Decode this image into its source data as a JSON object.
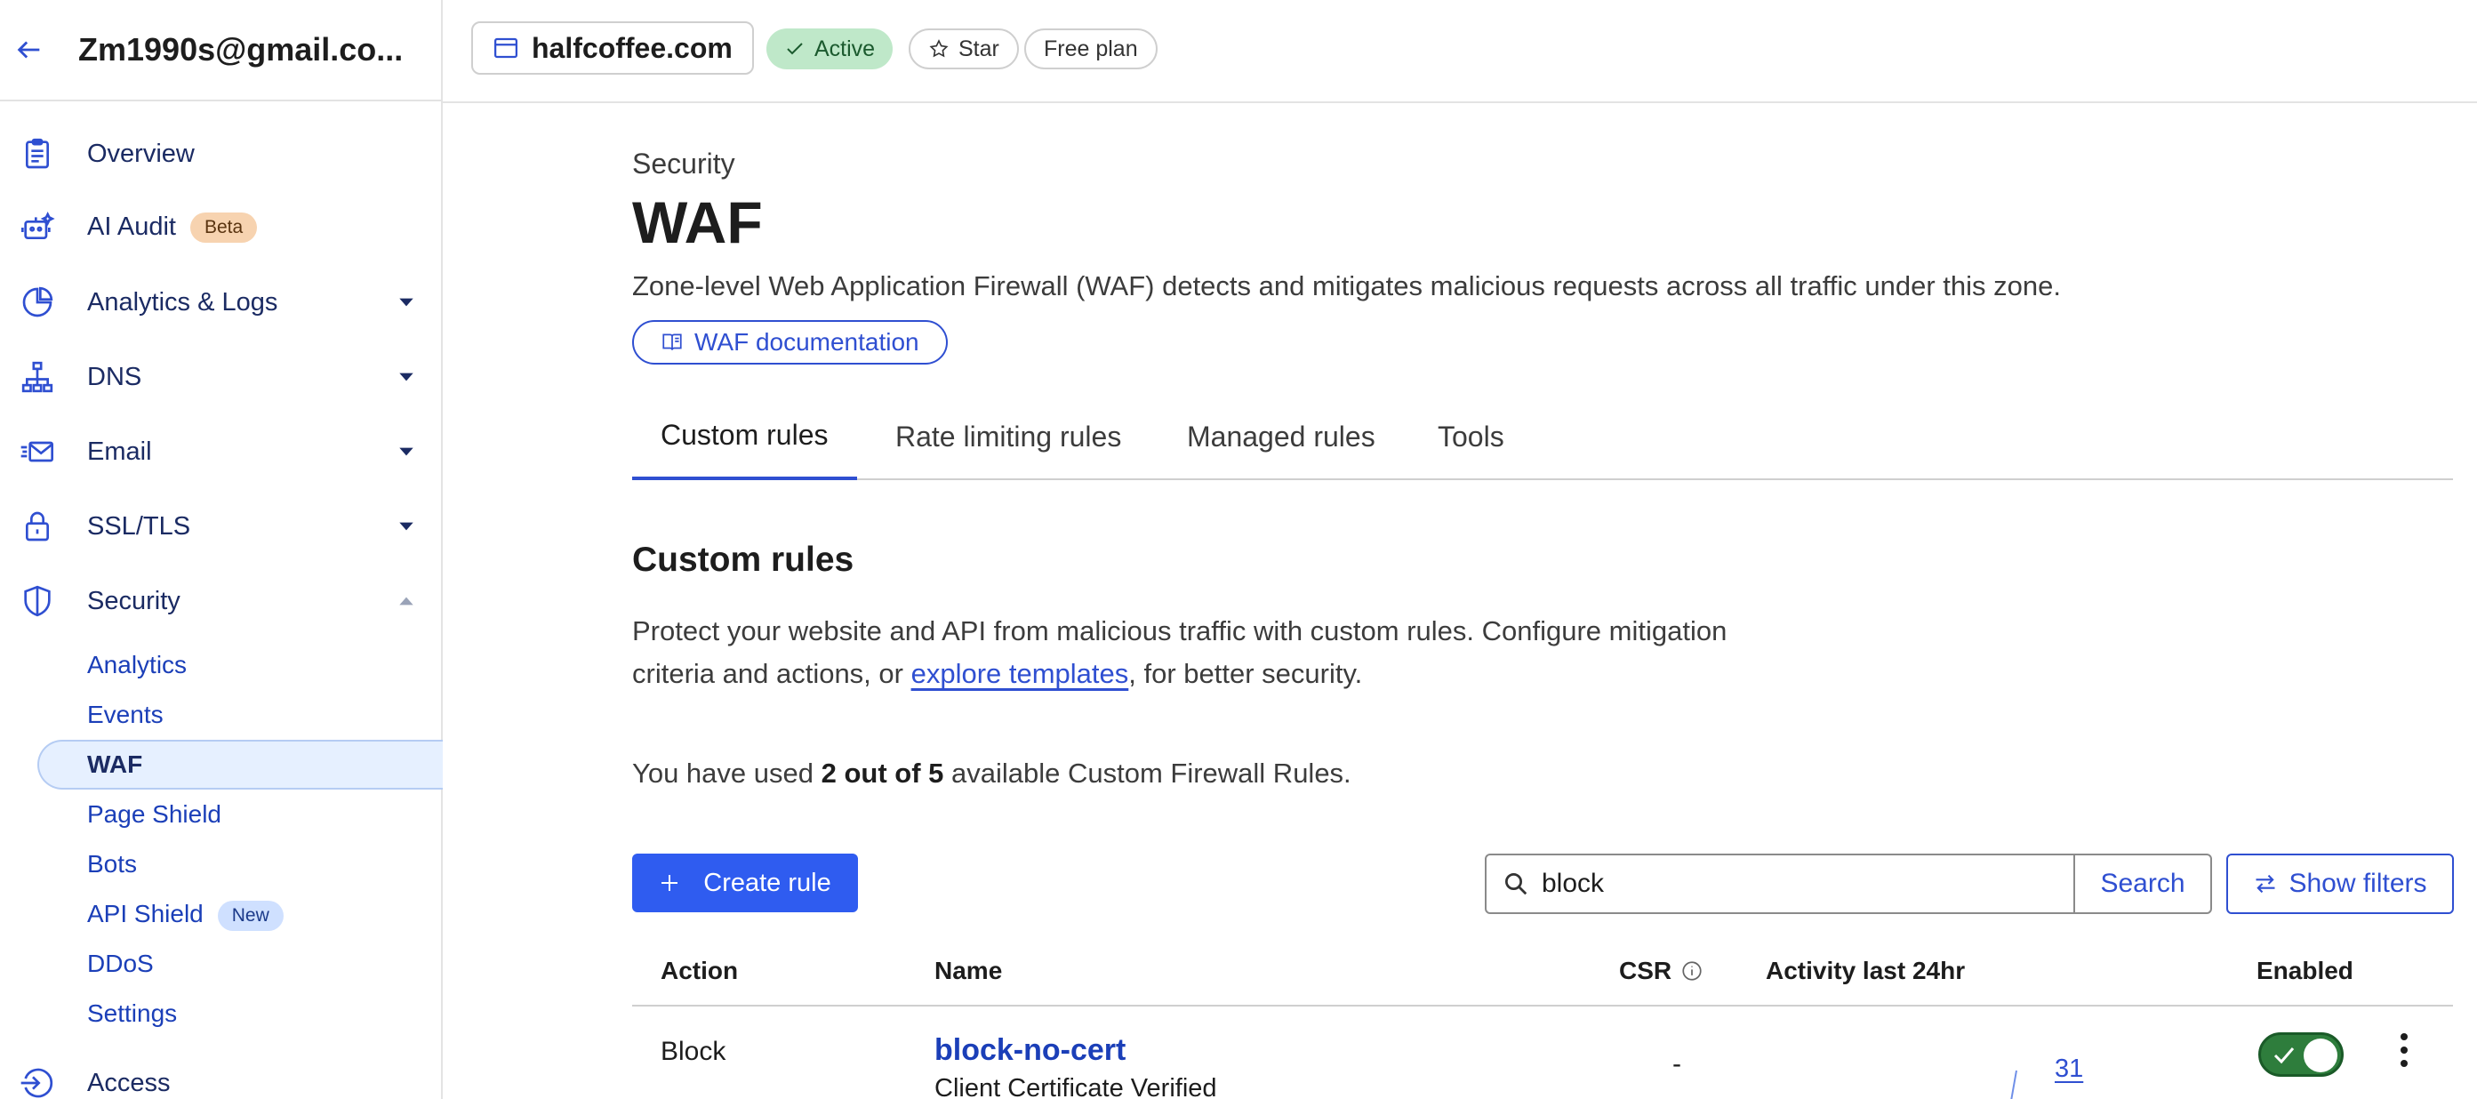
{
  "account": {
    "name": "Zm1990s@gmail.co..."
  },
  "sidebar": {
    "items": [
      {
        "label": "Overview",
        "icon": "clipboard-icon"
      },
      {
        "label": "AI Audit",
        "badge": "Beta",
        "icon": "robot-icon"
      },
      {
        "label": "Analytics & Logs",
        "icon": "pie-chart-icon"
      },
      {
        "label": "DNS",
        "icon": "network-icon"
      },
      {
        "label": "Email",
        "icon": "email-icon"
      },
      {
        "label": "SSL/TLS",
        "icon": "lock-icon"
      },
      {
        "label": "Security",
        "icon": "shield-icon"
      },
      {
        "label": "Access",
        "icon": "access-icon"
      }
    ],
    "security_sub": [
      "Analytics",
      "Events",
      "WAF",
      "Page Shield",
      "Bots",
      "API Shield",
      "DDoS",
      "Settings"
    ],
    "api_shield_badge": "New",
    "active_sub": "WAF"
  },
  "topbar": {
    "domain": "halfcoffee.com",
    "status": "Active",
    "star": "Star",
    "plan": "Free plan"
  },
  "page": {
    "eyebrow": "Security",
    "title": "WAF",
    "description": "Zone-level Web Application Firewall (WAF) detects and mitigates malicious requests across all traffic under this zone.",
    "doc_link": "WAF documentation",
    "tabs": [
      "Custom rules",
      "Rate limiting rules",
      "Managed rules",
      "Tools"
    ],
    "selected_tab": "Custom rules"
  },
  "custom_rules": {
    "heading": "Custom rules",
    "para_1": "Protect your website and API from malicious traffic with custom rules. Configure mitigation criteria and actions, or ",
    "para_link": "explore templates",
    "para_2": ", for better security.",
    "usage_pre": "You have used ",
    "usage_bold": "2 out of 5",
    "usage_post": " available Custom Firewall Rules.",
    "create_label": "Create rule",
    "search_value": "block",
    "search_label": "Search",
    "filters_label": "Show filters"
  },
  "table": {
    "columns": [
      "Action",
      "Name",
      "CSR",
      "Activity last 24hr",
      "Enabled"
    ],
    "rows": [
      {
        "action": "Block",
        "name": "block-no-cert",
        "description": "Client Certificate Verified",
        "csr": "-",
        "activity_count": "31",
        "enabled": true
      }
    ]
  },
  "colors": {
    "accent": "#2f4fd1",
    "primary_button": "#2f5cf0",
    "active_pill": "#bfe8c9",
    "toggle_on": "#2e7d3c"
  }
}
